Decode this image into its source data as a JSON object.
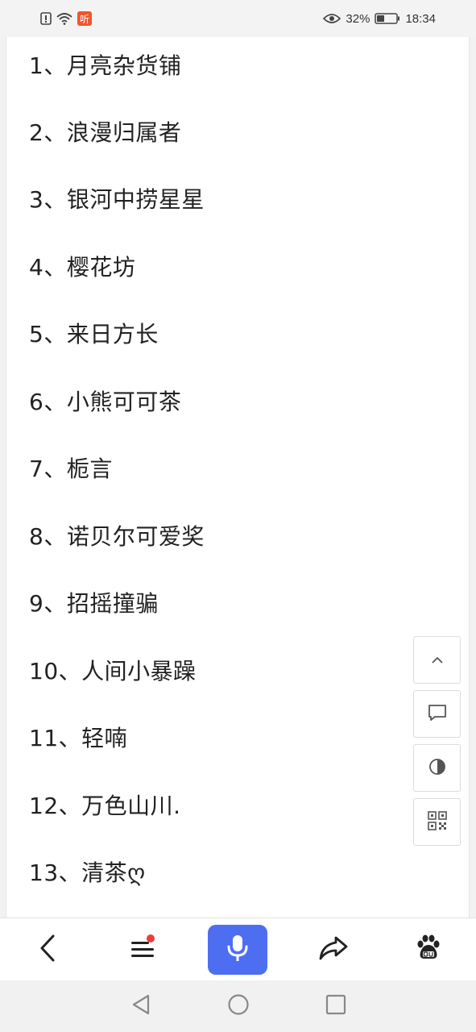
{
  "status_bar": {
    "battery_percent": "32%",
    "time": "18:34",
    "listen_badge": "听"
  },
  "list": {
    "items": [
      "1、月亮杂货铺",
      "2、浪漫归属者",
      "3、银河中捞星星",
      "4、樱花坊",
      "5、来日方长",
      "6、小熊可可茶",
      "7、栀言",
      "8、诺贝尔可爱奖",
      "9、招摇撞骗",
      "10、人间小暴躁",
      "11、轻喃",
      "12、万色山川.",
      "13、清茶ღ"
    ]
  },
  "floating_tools": {
    "icons": [
      "chevron-up-icon",
      "comment-icon",
      "contrast-icon",
      "qr-code-icon"
    ]
  },
  "bottom_toolbar": {
    "icons": [
      "back-arrow-icon",
      "menu-icon",
      "microphone-icon",
      "share-icon",
      "baidu-paw-icon"
    ],
    "accent": "#4e6ef2",
    "badge_color": "#f13a3a"
  },
  "system_nav": {
    "icons": [
      "nav-back-icon",
      "nav-home-icon",
      "nav-recents-icon"
    ]
  }
}
